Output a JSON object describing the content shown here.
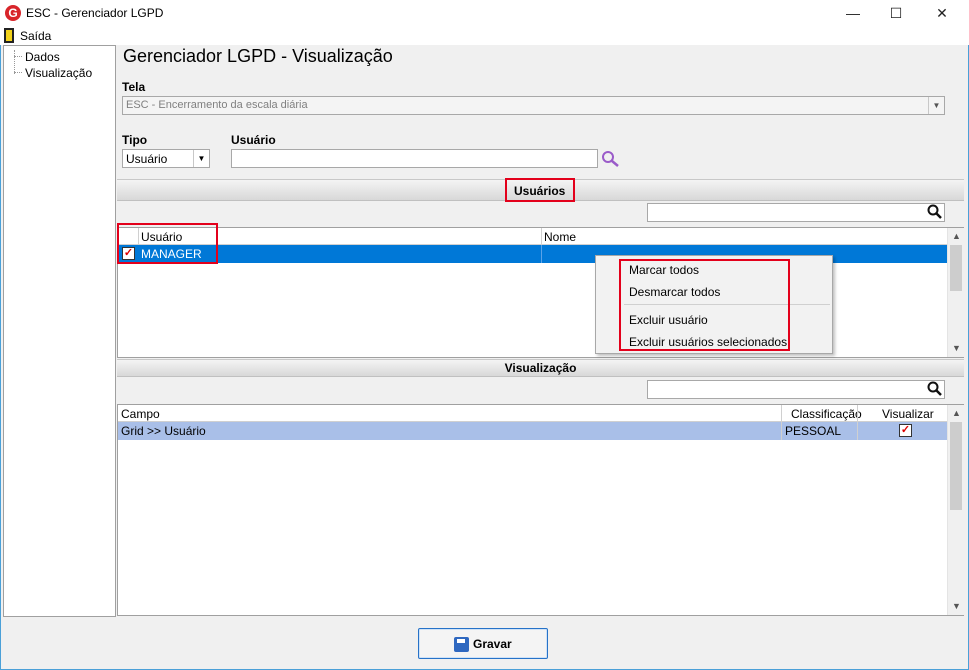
{
  "window": {
    "title": "ESC - Gerenciador LGPD",
    "logo_letter": "G",
    "minimize": "—",
    "maximize": "☐",
    "close": "✕"
  },
  "menu": {
    "exit_label": "Saída"
  },
  "tree": {
    "items": [
      "Dados",
      "Visualização"
    ]
  },
  "page": {
    "title": "Gerenciador LGPD - Visualização"
  },
  "tela": {
    "label": "Tela",
    "value": "ESC - Encerramento da escala diária"
  },
  "tipo": {
    "label": "Tipo",
    "value": "Usuário"
  },
  "usuario": {
    "label": "Usuário",
    "value": ""
  },
  "users_section": {
    "title": "Usuários",
    "search_value": "",
    "columns": [
      "Usuário",
      "Nome"
    ],
    "rows": [
      {
        "checked": true,
        "usuario": "MANAGER",
        "nome": ""
      }
    ]
  },
  "context_menu": {
    "items": [
      "Marcar todos",
      "Desmarcar todos",
      "Excluir usuário",
      "Excluir usuários selecionados"
    ]
  },
  "view_section": {
    "title": "Visualização",
    "search_value": "",
    "columns": [
      "Campo",
      "Classificação",
      "Visualizar"
    ],
    "rows": [
      {
        "campo": "Grid >> Usuário",
        "classificacao": "PESSOAL",
        "visualizar": true
      }
    ]
  },
  "buttons": {
    "save_label": "Gravar"
  },
  "colors": {
    "highlight": "#0078d7",
    "annotation_red": "#e3001b",
    "row_light": "#a9bfe8"
  }
}
